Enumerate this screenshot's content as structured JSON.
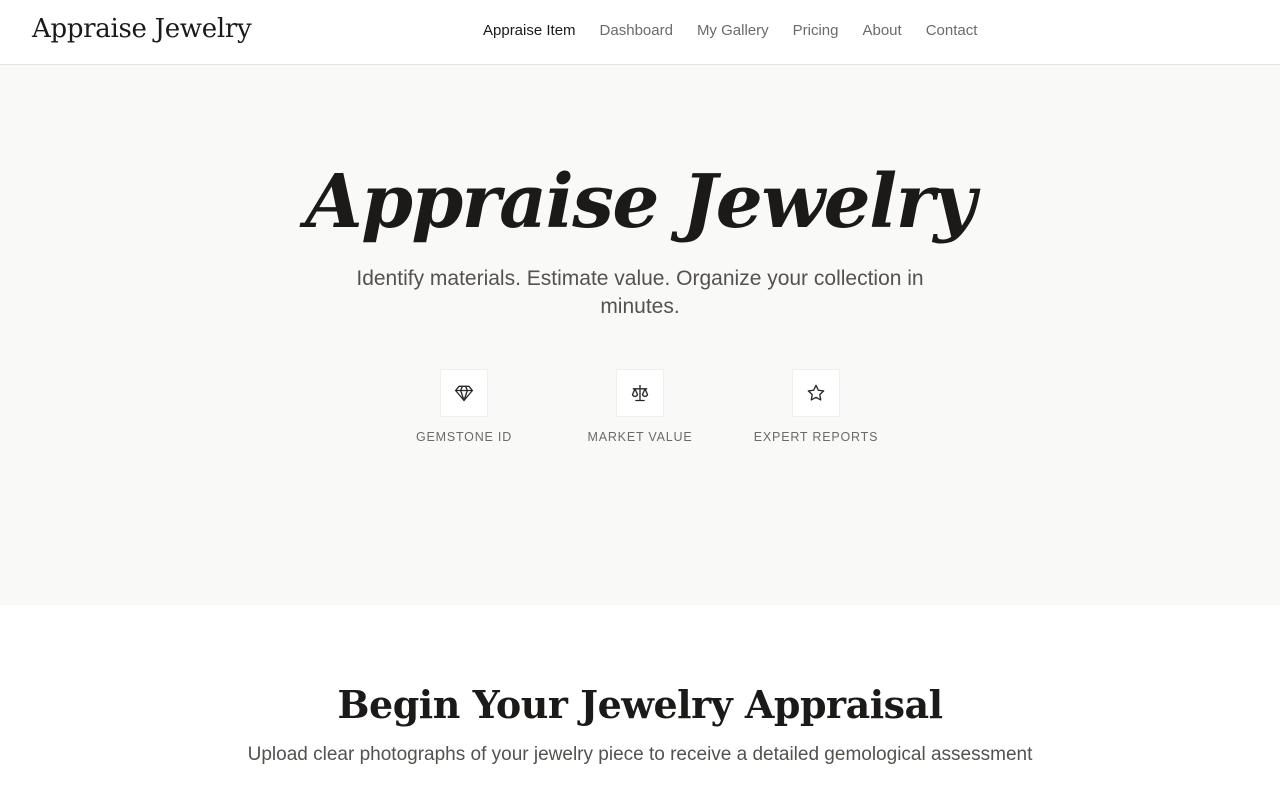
{
  "header": {
    "brand": "Appraise Jewelry",
    "nav": [
      {
        "label": "Appraise Item",
        "active": true
      },
      {
        "label": "Dashboard",
        "active": false
      },
      {
        "label": "My Gallery",
        "active": false
      },
      {
        "label": "Pricing",
        "active": false
      },
      {
        "label": "About",
        "active": false
      },
      {
        "label": "Contact",
        "active": false
      }
    ]
  },
  "hero": {
    "title": "Appraise Jewelry",
    "subtitle": "Identify materials. Estimate value. Organize your collection in minutes.",
    "features": [
      {
        "icon": "gem-icon",
        "label": "GEMSTONE ID"
      },
      {
        "icon": "scale-icon",
        "label": "MARKET VALUE"
      },
      {
        "icon": "star-icon",
        "label": "EXPERT REPORTS"
      }
    ]
  },
  "begin": {
    "title": "Begin Your Jewelry Appraisal",
    "subtitle": "Upload clear photographs of your jewelry piece to receive a detailed gemological assessment"
  },
  "colors": {
    "text": "#1c1a18",
    "muted": "#6e6a66",
    "hero_bg": "#f9f9f8"
  }
}
